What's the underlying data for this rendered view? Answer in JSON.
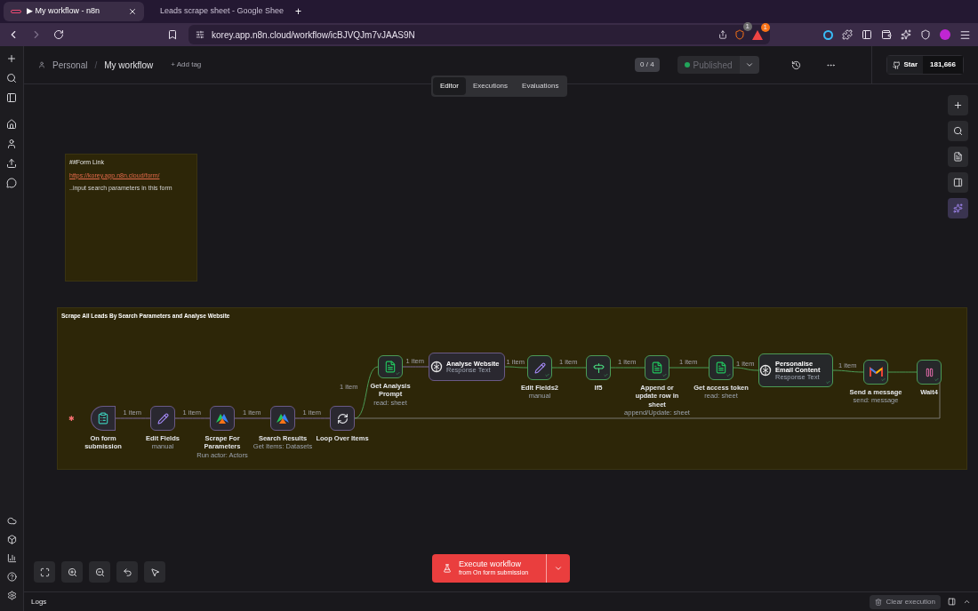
{
  "browser": {
    "tabs": [
      {
        "title": "▶ My workflow - n8n",
        "selected": true,
        "kind": "n8n"
      },
      {
        "title": "Leads scrape sheet - Google Shee",
        "selected": false,
        "kind": "sheets"
      }
    ],
    "new_tab": "+",
    "url": "korey.app.n8n.cloud/workflow/icBJVQJm7vJAAS9N",
    "shield_count": "1",
    "alert_count": "1"
  },
  "header": {
    "breadcrumb": [
      "Personal",
      "My workflow"
    ],
    "separator": "/",
    "add_tag": "+ Add tag",
    "counter": "0 / 4",
    "publish": {
      "label": "Published",
      "on": true
    },
    "star": {
      "label": "Star",
      "count": "181,666"
    }
  },
  "view_tabs": [
    {
      "label": "Editor",
      "selected": true
    },
    {
      "label": "Executions",
      "selected": false
    },
    {
      "label": "Evaluations",
      "selected": false
    }
  ],
  "sticky_note": {
    "title": "##Form Link",
    "link": "https://korey.app.n8n.cloud/form/",
    "text": "..input search parameters in this form"
  },
  "group": {
    "title": "Scrape All Leads By Search Parameters and Analyse Website"
  },
  "nodes": [
    {
      "name": "On form submission",
      "kind": "form",
      "executed": false
    },
    {
      "name": "Edit Fields",
      "subtitle": "manual",
      "kind": "pencil",
      "executed": false
    },
    {
      "name": "Scrape For Parameters",
      "subtitle": "Run actor: Actors",
      "kind": "apify",
      "executed": false
    },
    {
      "name": "Search Results",
      "subtitle": "Get Items: Datasets",
      "kind": "apify",
      "executed": false
    },
    {
      "name": "Loop Over Items",
      "kind": "loop",
      "executed": false
    },
    {
      "name": "Get Analysis Prompt",
      "subtitle": "read: sheet",
      "kind": "sheets",
      "executed": true
    },
    {
      "name": "Analyse Website",
      "subtitle": "Response Text",
      "kind": "openai",
      "executed": false
    },
    {
      "name": "Edit Fields2",
      "subtitle": "manual",
      "kind": "pencil",
      "executed": true
    },
    {
      "name": "If5",
      "kind": "if",
      "executed": true
    },
    {
      "name": "Append or update row in sheet",
      "subtitle": "append/Update: sheet",
      "kind": "sheets",
      "executed": true
    },
    {
      "name": "Get access token",
      "subtitle": "read: sheet",
      "kind": "sheets",
      "executed": true
    },
    {
      "name": "Personalise Email Content",
      "subtitle": "Response Text",
      "kind": "openai",
      "executed": true
    },
    {
      "name": "Send a message",
      "subtitle": "send: message",
      "kind": "gmail",
      "executed": true
    },
    {
      "name": "Wait4",
      "kind": "wait",
      "executed": true
    }
  ],
  "trigger_marker": "✱",
  "edges": [
    {
      "label": "1 item"
    },
    {
      "label": "1 item"
    },
    {
      "label": "1 item"
    },
    {
      "label": "1 item"
    },
    {
      "label": "1 item"
    },
    {
      "label": "1 item"
    },
    {
      "label": "1 item"
    },
    {
      "label": "1 item"
    },
    {
      "label": "1 item"
    },
    {
      "label": "1 item"
    },
    {
      "label": "1 item"
    },
    {
      "label": "1 item"
    }
  ],
  "execute": {
    "label": "Execute workflow",
    "sub": "from On form submission"
  },
  "logs": {
    "label": "Logs",
    "clear": "Clear execution"
  }
}
